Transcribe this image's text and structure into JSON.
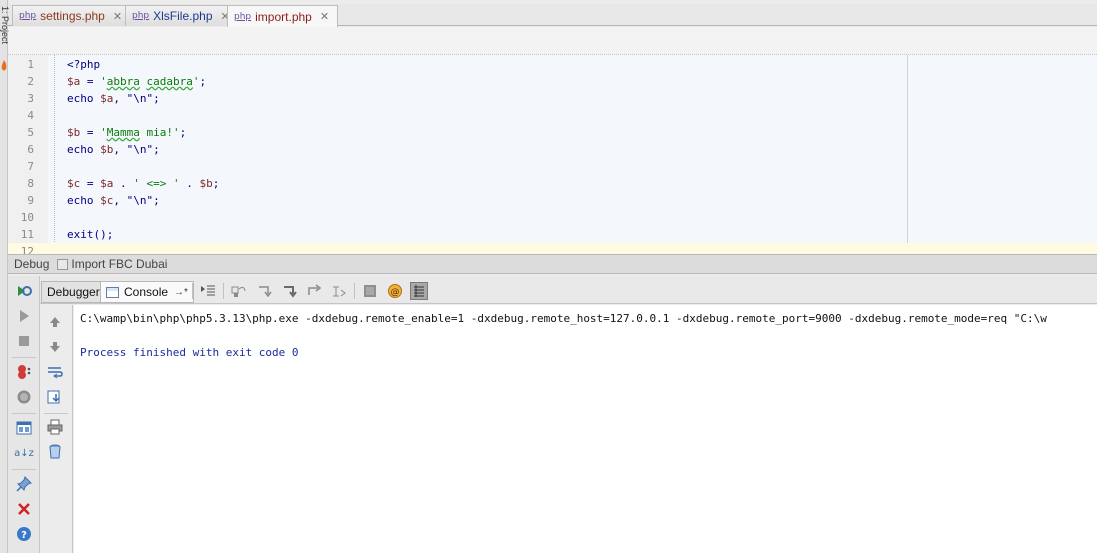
{
  "side_panel": {
    "label": "1: Project"
  },
  "tabs": [
    {
      "label": "settings.php",
      "type": "php",
      "active": false
    },
    {
      "label": "XlsFile.php",
      "type": "php",
      "active": false
    },
    {
      "label": "import.php",
      "type": "php",
      "active": true
    }
  ],
  "editor": {
    "lines": [
      {
        "n": "1",
        "text": "<?php"
      },
      {
        "n": "2",
        "text": "$a = 'abbra cadabra';"
      },
      {
        "n": "3",
        "text": "echo $a, \"\\n\";"
      },
      {
        "n": "4",
        "text": ""
      },
      {
        "n": "5",
        "text": "$b = 'Mamma mia!';"
      },
      {
        "n": "6",
        "text": "echo $b, \"\\n\";"
      },
      {
        "n": "7",
        "text": ""
      },
      {
        "n": "8",
        "text": "$c = $a . ' <=> ' . $b;"
      },
      {
        "n": "9",
        "text": "echo $c, \"\\n\";"
      },
      {
        "n": "10",
        "text": ""
      },
      {
        "n": "11",
        "text": "exit();"
      },
      {
        "n": "12",
        "text": ""
      }
    ]
  },
  "debug": {
    "title": "Debug",
    "config_name": "Import FBC Dubai",
    "tabs": [
      {
        "label": "Debugger"
      },
      {
        "label": "Console",
        "suffix": "→*"
      }
    ],
    "console_lines": [
      "C:\\wamp\\bin\\php\\php5.3.13\\php.exe -dxdebug.remote_enable=1 -dxdebug.remote_host=127.0.0.1 -dxdebug.remote_port=9000 -dxdebug.remote_mode=req \"C:\\w",
      "",
      "Process finished with exit code 0"
    ]
  },
  "icons": {
    "tab_file": "php-file-icon",
    "close": "close-icon",
    "left_toolbar": [
      "rerun-icon",
      "resume-icon",
      "stop-icon",
      "view-breakpoints-icon",
      "mute-breakpoints-icon",
      "restore-layout-icon",
      "sort-icon",
      "pin-icon",
      "close-icon",
      "help-icon"
    ],
    "console_toolbar": [
      "up-arrow-icon",
      "down-arrow-icon",
      "soft-wrap-icon",
      "scroll-to-end-icon",
      "print-icon",
      "clear-all-icon"
    ]
  }
}
